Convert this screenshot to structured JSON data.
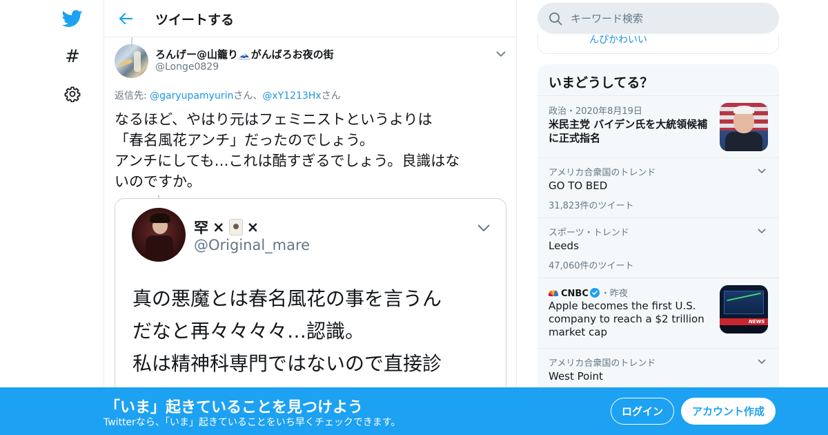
{
  "nav": {
    "icons": [
      "twitter-bird-icon",
      "hashtag-icon",
      "gear-icon"
    ],
    "hash_glyph": "#"
  },
  "header": {
    "title": "ツイートする"
  },
  "tweet": {
    "display_name": "ろんげー@山籠り🗻がんばろお夜の街",
    "screen_name": "@Longe0829",
    "reply_prefix": "返信先: ",
    "reply_to": [
      "@garyupamyurin",
      "@xY1213Hx"
    ],
    "reply_suffix_1": "さん、",
    "reply_suffix_2": "さん",
    "text_lines": [
      "なるほど、やはり元はフェミニストというよりは",
      "「春名風花アンチ」だったのでしょう。",
      "アンチにしても…これは酷すぎるでしょう。良識はな",
      "いのですか。"
    ]
  },
  "quote": {
    "name_prefix": "罕",
    "name_sep1": "×",
    "name_sep2": "×",
    "screen_name": "@Original_mare",
    "text_lines": [
      "真の悪魔とは春名風花の事を言うん",
      "だなと再々々々々…認識。",
      "私は精神科専門ではないので直接診"
    ]
  },
  "search": {
    "placeholder": "キーワード検索"
  },
  "prev_card": {
    "text": "んぴかわいい"
  },
  "trends": {
    "title": "いまどうしてる？",
    "items": [
      {
        "meta": "政治・2020年8月19日",
        "name": "米民主党 バイデン氏を大統領候補に正式指名"
      },
      {
        "meta": "アメリカ合衆国のトレンド",
        "name": "GO TO BED",
        "count": "31,823件のツイート"
      },
      {
        "meta": "スポーツ・トレンド",
        "name": "Leeds",
        "count": "47,060件のツイート"
      },
      {
        "source": "CNBC",
        "time": "・昨夜",
        "name": "Apple becomes the first U.S. company to reach a $2 trillion market cap",
        "thumb_text": "NEWS"
      },
      {
        "meta": "アメリカ合衆国のトレンド",
        "name": "West Point"
      }
    ]
  },
  "bottom_bar": {
    "title": "「いま」起きていることを見つけよう",
    "subtitle": "Twitterなら、「いま」起きていることをいち早くチェックできます。",
    "login": "ログイン",
    "signup": "アカウント作成"
  },
  "colors": {
    "brand": "#1da1f2",
    "link": "#1b95e0",
    "secondary_text": "#657786",
    "border": "#e6ecf0"
  }
}
